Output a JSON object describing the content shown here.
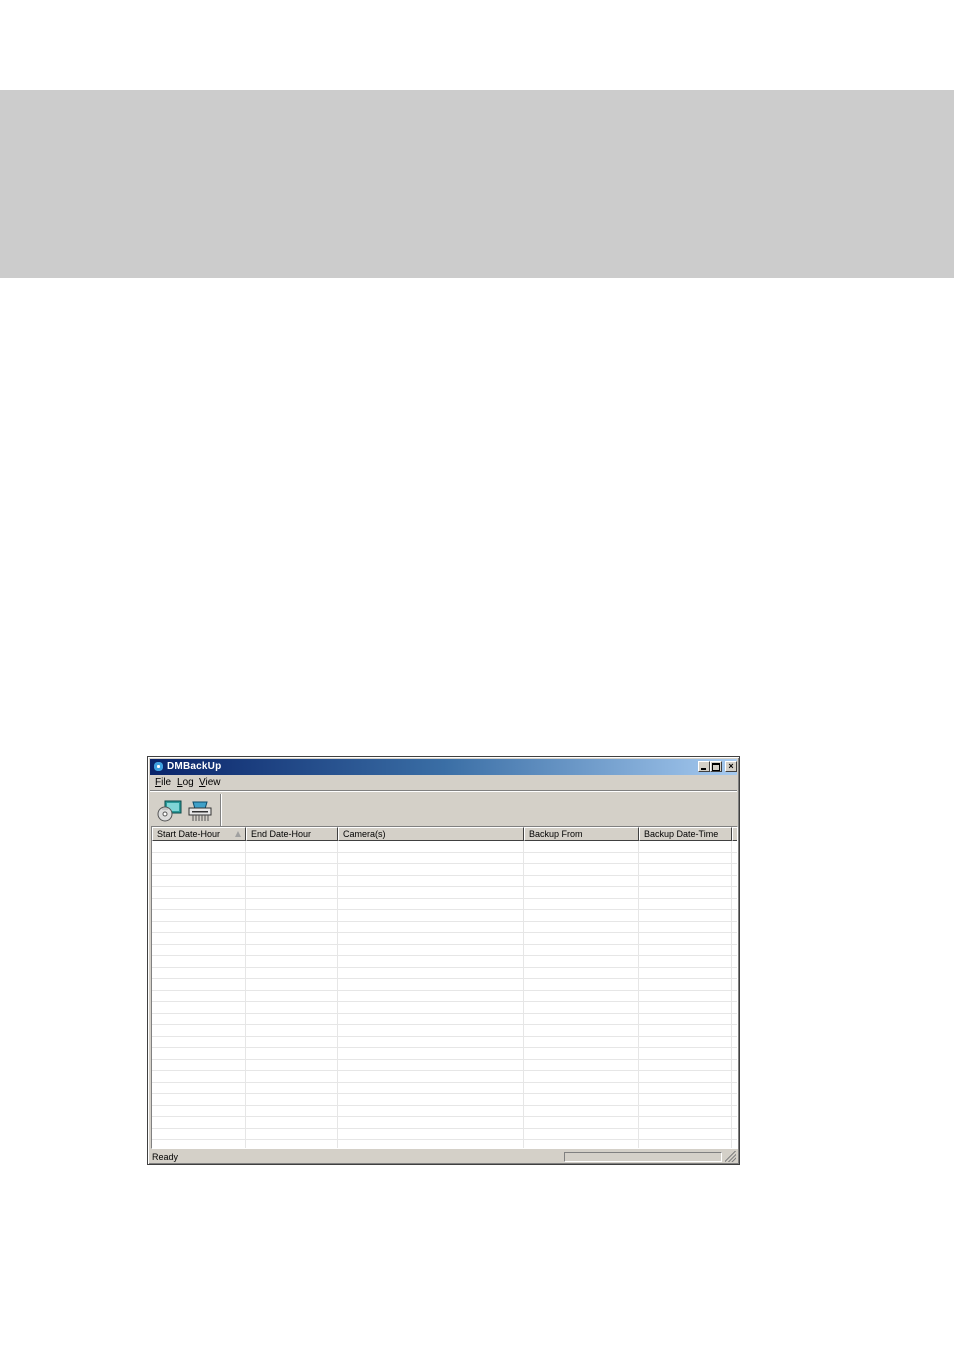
{
  "window": {
    "title": "DMBackUp"
  },
  "menu": {
    "file": {
      "accel": "F",
      "rest": "ile"
    },
    "log": {
      "accel": "L",
      "rest": "og"
    },
    "view": {
      "accel": "V",
      "rest": "iew"
    }
  },
  "toolbar": {
    "buttons": [
      {
        "icon": "backup-disc-icon"
      },
      {
        "icon": "shredder-icon"
      }
    ]
  },
  "table": {
    "columns": [
      "Start Date-Hour",
      "End Date-Hour",
      "Camera(s)",
      "Backup From",
      "Backup Date-Time"
    ],
    "sorted_column": "Start Date-Hour",
    "sort_direction": "ascending",
    "rows": []
  },
  "status": {
    "text": "Ready"
  }
}
